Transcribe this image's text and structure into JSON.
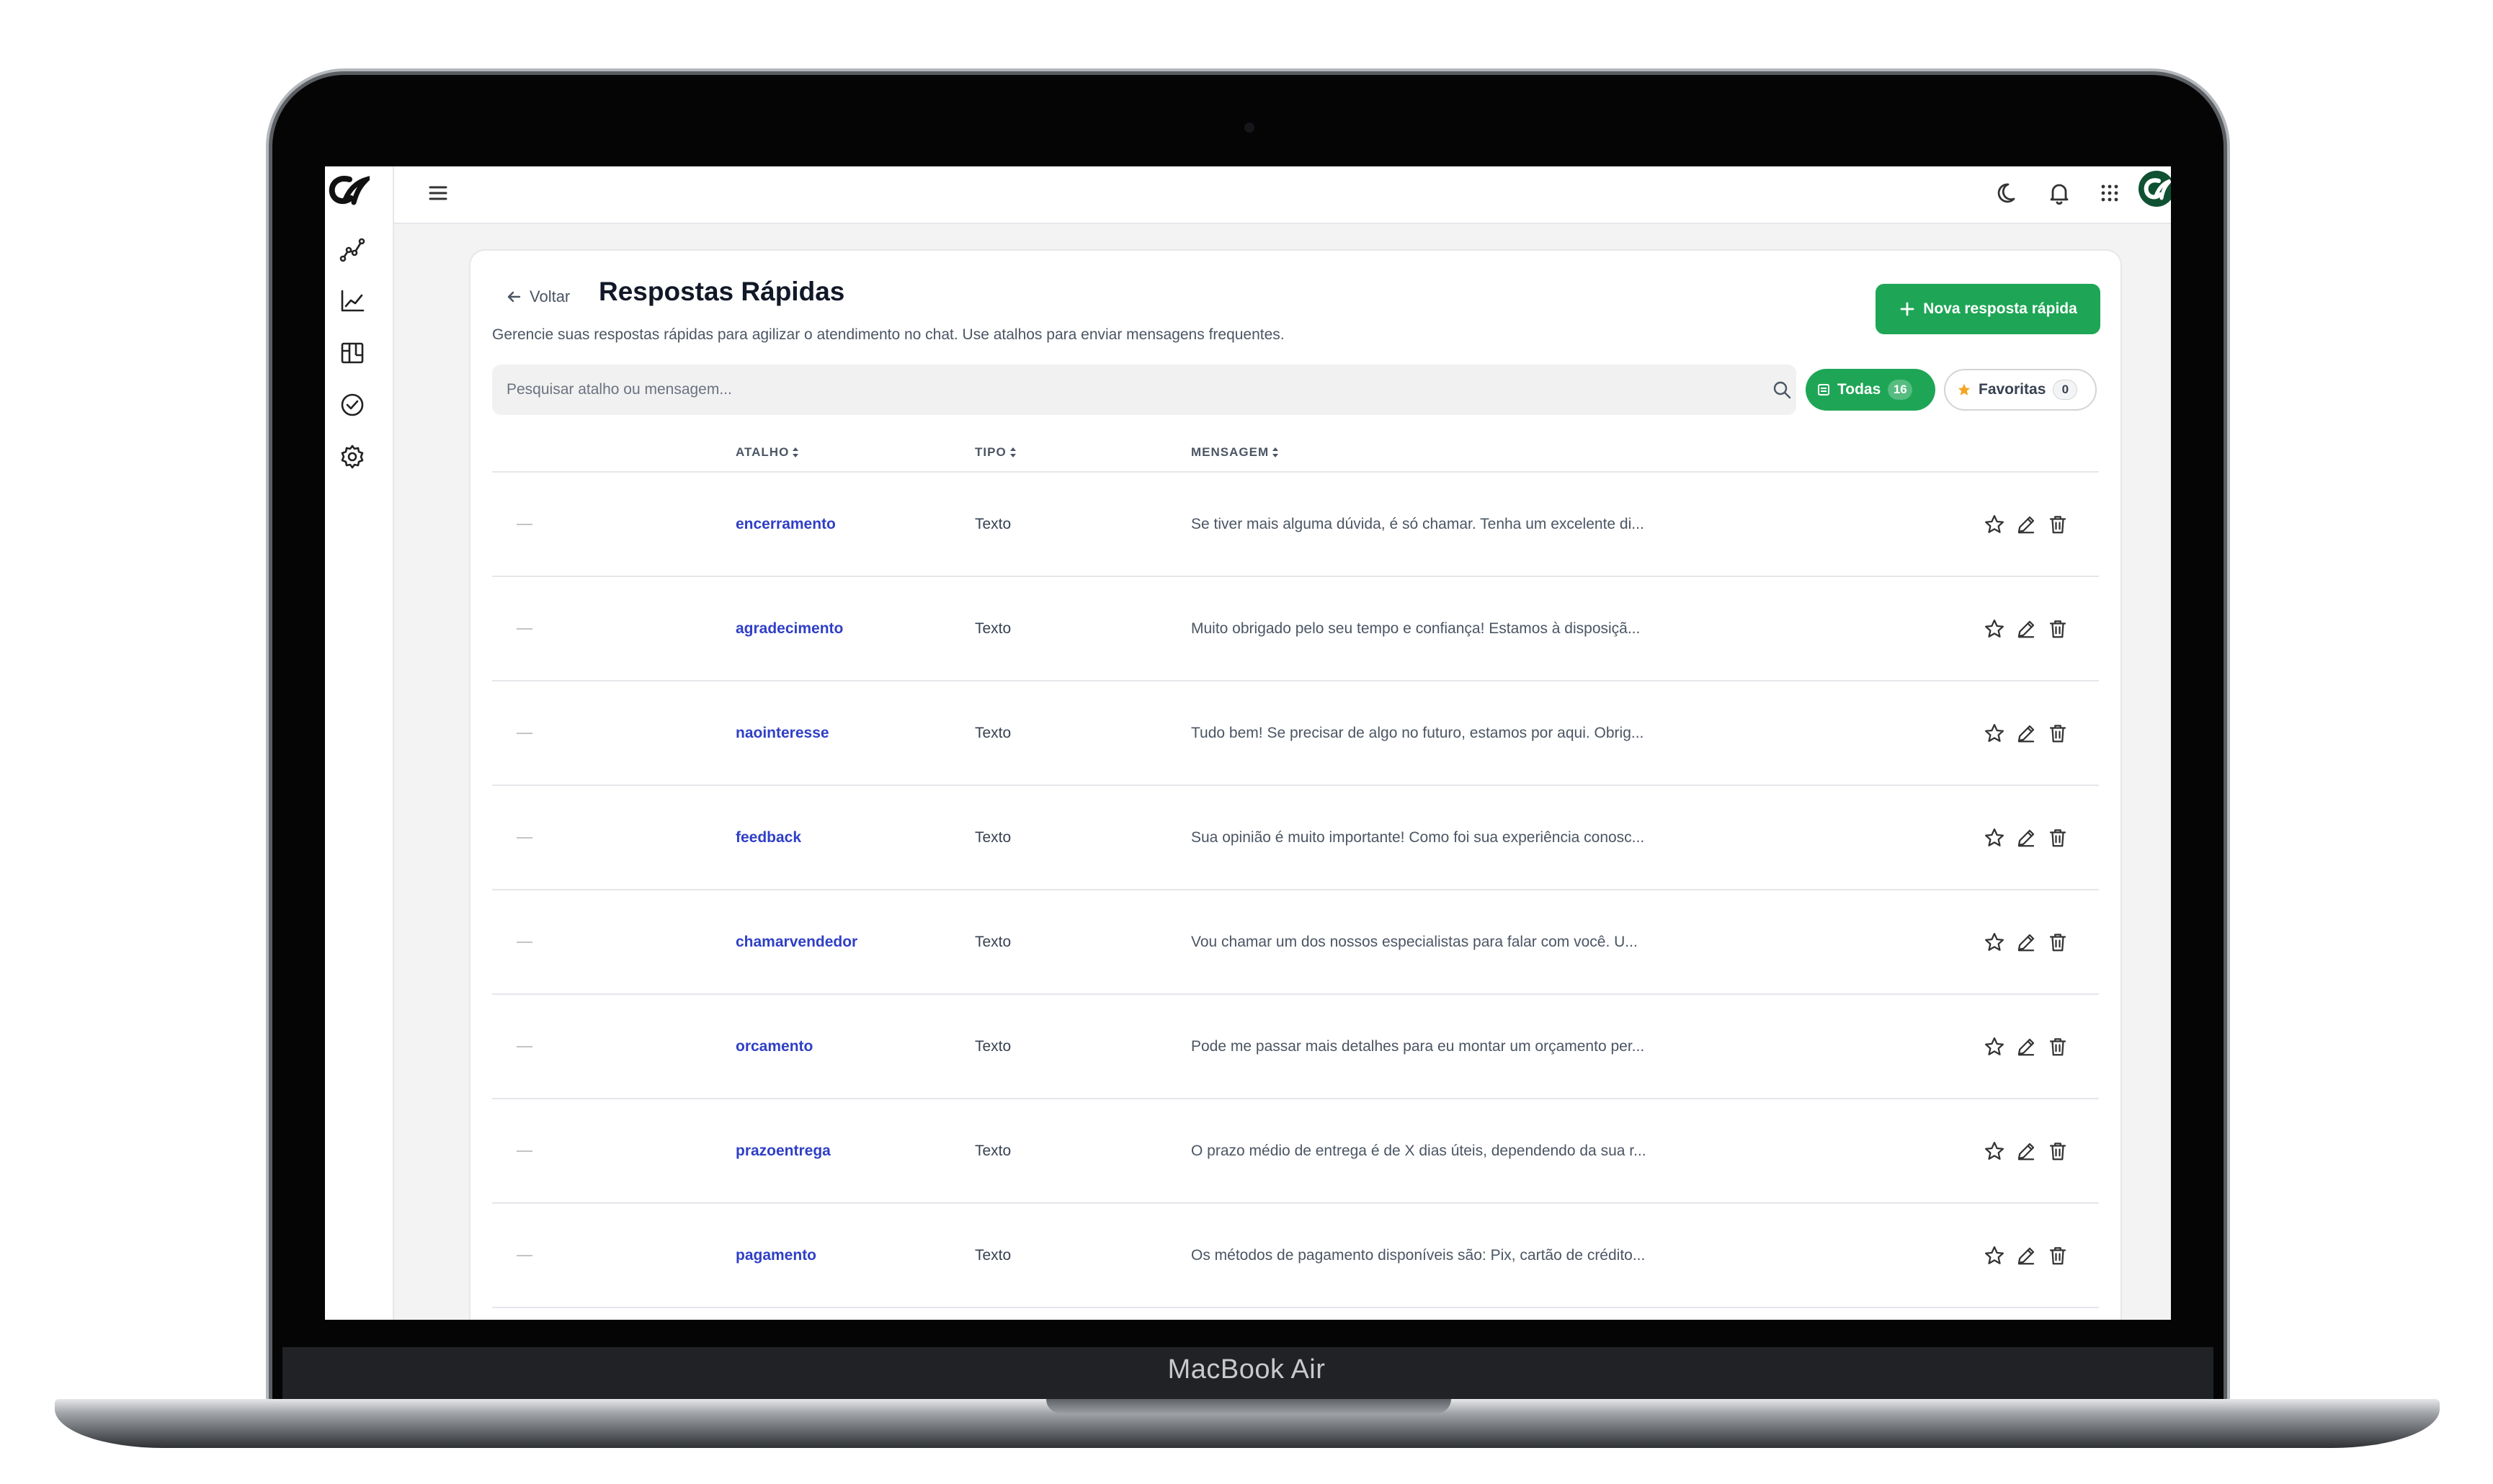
{
  "device": {
    "brand_label": "MacBook Air"
  },
  "topbar": {
    "menu_icon": "hamburger-icon",
    "icons": [
      "moon-icon",
      "bell-icon",
      "apps-grid-icon"
    ],
    "avatar": "user-avatar"
  },
  "sidebar": {
    "logo": "cr-logo",
    "items": [
      {
        "icon": "analytics-nodes-icon"
      },
      {
        "icon": "line-chart-icon"
      },
      {
        "icon": "kanban-board-icon"
      },
      {
        "icon": "check-circle-icon"
      },
      {
        "icon": "gear-icon"
      }
    ]
  },
  "page": {
    "back_label": "Voltar",
    "title": "Respostas Rápidas",
    "subtitle": "Gerencie suas respostas rápidas para agilizar o atendimento no chat. Use atalhos para enviar mensagens frequentes.",
    "new_button_label": "Nova resposta rápida"
  },
  "search": {
    "placeholder": "Pesquisar atalho ou mensagem...",
    "value": ""
  },
  "filters": {
    "all": {
      "label": "Todas",
      "count": "16"
    },
    "favorites": {
      "label": "Favoritas",
      "count": "0"
    }
  },
  "table": {
    "columns": [
      {
        "label": "ATALHO"
      },
      {
        "label": "TIPO"
      },
      {
        "label": "MENSAGEM"
      }
    ],
    "rows": [
      {
        "shortcut": "encerramento",
        "type": "Texto",
        "message": "Se tiver mais alguma dúvida, é só chamar. Tenha um excelente di..."
      },
      {
        "shortcut": "agradecimento",
        "type": "Texto",
        "message": "Muito obrigado pelo seu tempo e confiança! Estamos à disposiçã..."
      },
      {
        "shortcut": "naointeresse",
        "type": "Texto",
        "message": "Tudo bem! Se precisar de algo no futuro, estamos por aqui. Obrig..."
      },
      {
        "shortcut": "feedback",
        "type": "Texto",
        "message": "Sua opinião é muito importante! Como foi sua experiência conosc..."
      },
      {
        "shortcut": "chamarvendedor",
        "type": "Texto",
        "message": "Vou chamar um dos nossos especialistas para falar com você. U..."
      },
      {
        "shortcut": "orcamento",
        "type": "Texto",
        "message": "Pode me passar mais detalhes para eu montar um orçamento per..."
      },
      {
        "shortcut": "prazoentrega",
        "type": "Texto",
        "message": "O prazo médio de entrega é de X dias úteis, dependendo da sua r..."
      },
      {
        "shortcut": "pagamento",
        "type": "Texto",
        "message": "Os métodos de pagamento disponíveis são: Pix, cartão de crédito..."
      }
    ]
  },
  "colors": {
    "accent": "#1ea656",
    "shortcut_text": "#2f3fc6",
    "background": "#f3f3f3"
  }
}
